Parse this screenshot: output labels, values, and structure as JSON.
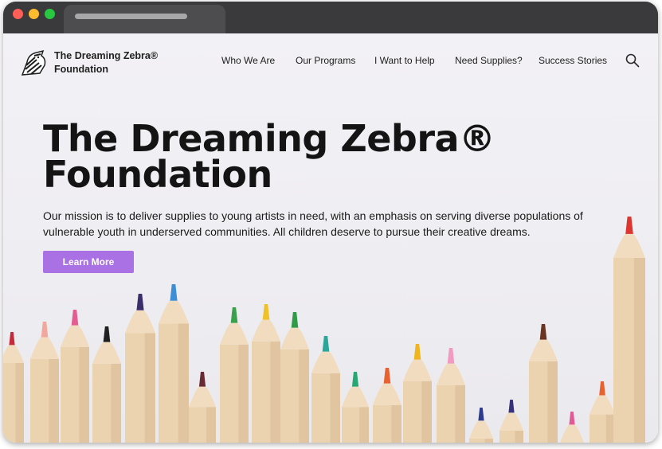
{
  "browser": {
    "tab_count": 1
  },
  "header": {
    "logo_line1": "The Dreaming Zebra®",
    "logo_line2": "Foundation",
    "nav": [
      {
        "label": "Who We Are"
      },
      {
        "label": "Our Programs"
      },
      {
        "label": "I Want to Help"
      },
      {
        "label": "Need Supplies?"
      },
      {
        "label": "Success Stories"
      }
    ]
  },
  "hero": {
    "title_line1": "The Dreaming Zebra®",
    "title_line2": "Foundation",
    "text": "Our mission is to deliver supplies to young artists in need, with an emphasis on serving diverse populations of vulnerable youth in underserved communities.  All children deserve to pursue their creative dreams.",
    "button_label": "Learn More"
  },
  "colors": {
    "button": "#a971e3",
    "pencil_wood": "#ecd3b0"
  },
  "pencils": [
    {
      "color": "#c42b3a"
    },
    {
      "color": "#f2a79c"
    },
    {
      "color": "#e45c92"
    },
    {
      "color": "#202020"
    },
    {
      "color": "#3b2e6b"
    },
    {
      "color": "#3c8fd6"
    },
    {
      "color": "#6a2a33"
    },
    {
      "color": "#3aa04b"
    },
    {
      "color": "#f0c22a"
    },
    {
      "color": "#2f9b47"
    },
    {
      "color": "#2aa79a"
    },
    {
      "color": "#27a772"
    },
    {
      "color": "#e8622f"
    },
    {
      "color": "#f0b41c"
    },
    {
      "color": "#f19bc2"
    },
    {
      "color": "#2c3b8f"
    },
    {
      "color": "#36317a"
    },
    {
      "color": "#6b3524"
    },
    {
      "color": "#e25a93"
    },
    {
      "color": "#e8622f"
    },
    {
      "color": "#dd3530"
    }
  ]
}
